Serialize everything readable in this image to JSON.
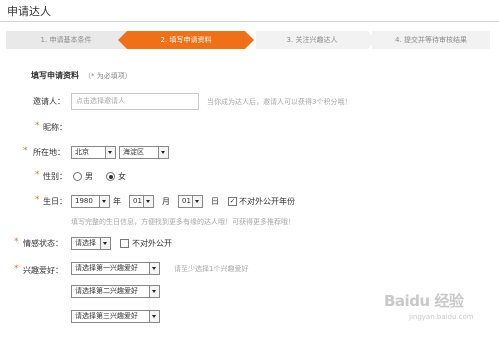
{
  "page": {
    "title": "申请达人"
  },
  "steps": [
    {
      "label": "1. 申请基本条件",
      "state": "done"
    },
    {
      "label": "2. 填写申请资料",
      "state": "active"
    },
    {
      "label": "3. 关注兴趣达人",
      "state": "todo"
    },
    {
      "label": "4. 提交并等待审核结果",
      "state": "todo"
    }
  ],
  "form": {
    "section_title": "填写申请资料",
    "required_note": "（* 为必填项）",
    "inviter": {
      "label": "邀请人：",
      "placeholder": "点击选择邀请人",
      "hint": "当你成为达人后，邀请人可以获得3个积分哦！"
    },
    "nickname": {
      "label": "昵称："
    },
    "location": {
      "label": "所在地：",
      "province": "北京",
      "district": "海淀区"
    },
    "gender": {
      "label": "性别：",
      "male": "男",
      "female": "女",
      "selected": "female"
    },
    "birthday": {
      "label": "生日：",
      "year": "1980",
      "year_unit": "年",
      "month": "01",
      "month_unit": "月",
      "day": "01",
      "day_unit": "日",
      "hide_year_label": "不对外公开年份",
      "hide_year_checked": true,
      "hint": "填写完整的生日信息，方便找到更多有缘的达人哦！可获得更多推荐哦！"
    },
    "relationship": {
      "label": "情感状态：",
      "select": "请选择",
      "hide_label": "不对外公开",
      "hide_checked": false
    },
    "interests": {
      "label": "兴趣爱好：",
      "select1": "请选择第一兴趣爱好",
      "select2": "请选择第二兴趣爱好",
      "select3": "请选择第三兴趣爱好",
      "hint": "请至少选择1个兴趣爱好"
    }
  },
  "watermark": {
    "brand": "Baidu 经验",
    "url": "jingyan.baidu.com"
  },
  "colors": {
    "accent": "#f07017",
    "required": "#e8711e"
  }
}
